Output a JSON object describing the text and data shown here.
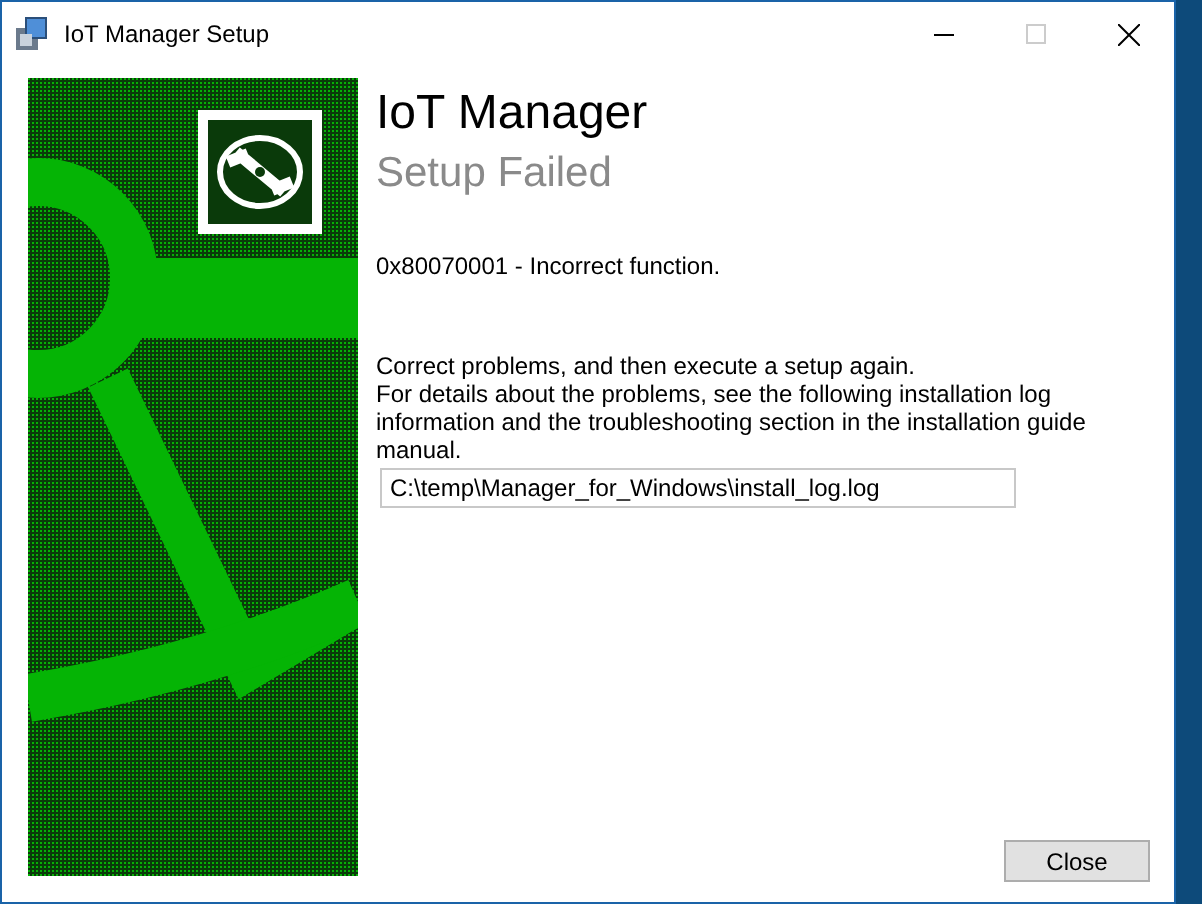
{
  "window": {
    "title": "IoT Manager Setup",
    "maximize_disabled": true
  },
  "heading": {
    "title": "IoT Manager",
    "subtitle": "Setup Failed"
  },
  "error": "0x80070001 - Incorrect function.",
  "message": [
    "Correct problems, and then execute a setup again.",
    "For details about the problems, see the following installation log information and the troubleshooting section in the installation guide manual."
  ],
  "log_path": {
    "value": "C:\\temp\\Manager_for_Windows\\install_log.log"
  },
  "buttons": [
    "Close"
  ]
}
